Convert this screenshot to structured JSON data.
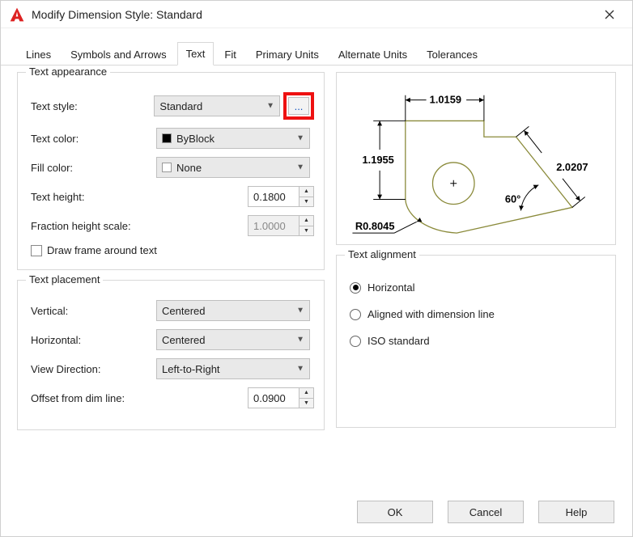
{
  "titlebar": {
    "title": "Modify Dimension Style: Standard"
  },
  "tabs": [
    "Lines",
    "Symbols and Arrows",
    "Text",
    "Fit",
    "Primary Units",
    "Alternate Units",
    "Tolerances"
  ],
  "active_tab": "Text",
  "appearance": {
    "legend": "Text appearance",
    "text_style_label": "Text style:",
    "text_style_value": "Standard",
    "text_color_label": "Text color:",
    "text_color_value": "ByBlock",
    "fill_color_label": "Fill color:",
    "fill_color_value": "None",
    "text_height_label": "Text height:",
    "text_height_value": "0.1800",
    "fraction_scale_label": "Fraction height scale:",
    "fraction_scale_value": "1.0000",
    "draw_frame_label": "Draw frame around text",
    "ellipsis": "..."
  },
  "placement": {
    "legend": "Text placement",
    "vertical_label": "Vertical:",
    "vertical_value": "Centered",
    "horizontal_label": "Horizontal:",
    "horizontal_value": "Centered",
    "viewdir_label": "View Direction:",
    "viewdir_value": "Left-to-Right",
    "offset_label": "Offset from dim line:",
    "offset_value": "0.0900"
  },
  "alignment": {
    "legend": "Text alignment",
    "opt_horizontal": "Horizontal",
    "opt_aligned": "Aligned with dimension line",
    "opt_iso": "ISO standard",
    "selected": "Horizontal"
  },
  "preview": {
    "dim_top": "1.0159",
    "dim_left": "1.1955",
    "dim_diag": "2.0207",
    "dim_angle": "60°",
    "dim_radius": "R0.8045"
  },
  "buttons": {
    "ok": "OK",
    "cancel": "Cancel",
    "help": "Help"
  }
}
